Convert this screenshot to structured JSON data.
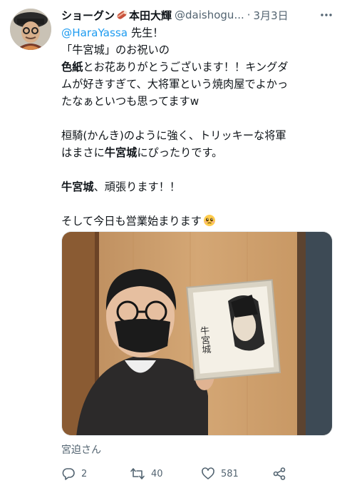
{
  "author": {
    "name_prefix": "ショーグン",
    "name_suffix": "本田大輝",
    "handle": "@daishogu...",
    "separator": "·",
    "date": "3月3日"
  },
  "tweet": {
    "mention": "@HaraYassa",
    "line1_rest": " 先生！",
    "line2": "「牛宮城」のお祝いの",
    "line3_bold": "色紙",
    "line3_rest": "とお花ありがとうございます！！キングダ",
    "line4": "ムが好きすぎて、大将軍という焼肉屋でよかっ",
    "line5": "たなぁといつも思ってますw",
    "line6": "桓騎(かんき)のように強く、トリッキーな将軍",
    "line7_a": "はまさに",
    "line7_bold": "牛宮城",
    "line7_b": "にぴったりです。",
    "line8_bold": "牛宮城",
    "line8_rest": "、頑張ります！！",
    "line9": "そして今日も営業始まります"
  },
  "media": {
    "caption": "宮迫さん",
    "shikishi_text": "牛宮城"
  },
  "actions": {
    "replies": "2",
    "retweets": "40",
    "likes": "581"
  },
  "colors": {
    "mention": "#1d9bf0",
    "secondary_text": "#536471",
    "primary_text": "#0f1419"
  },
  "icons": {
    "more": "more-icon",
    "reply": "reply-icon",
    "retweet": "retweet-icon",
    "like": "heart-icon",
    "share": "share-icon",
    "name_emoji": "meat-emoji-icon",
    "face_emoji": "pleading-face-emoji-icon"
  }
}
